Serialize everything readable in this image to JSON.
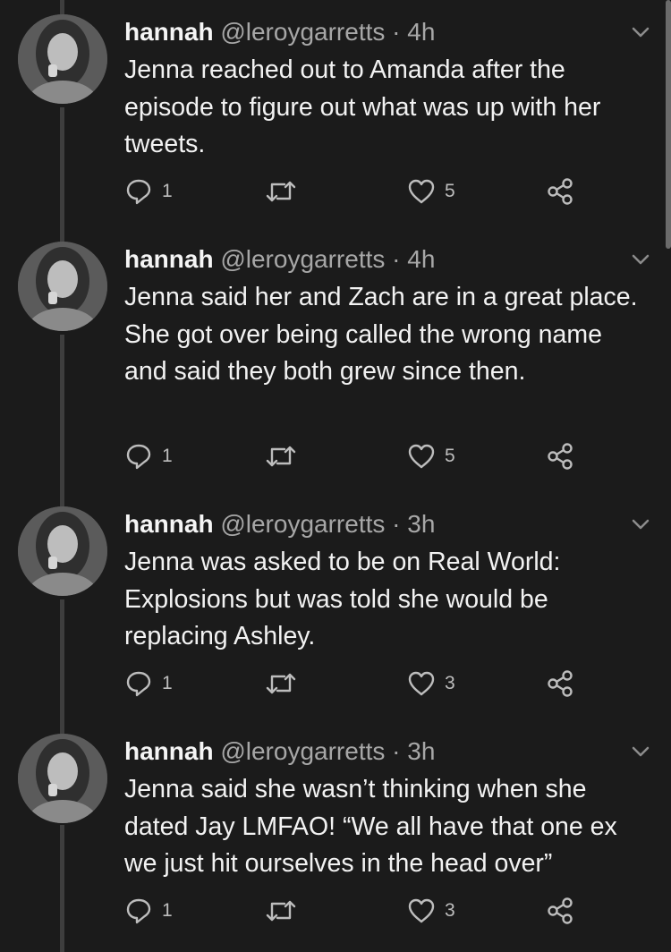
{
  "thread": {
    "tweets": [
      {
        "name": "hannah",
        "handle": "@leroygarretts",
        "separator": " · ",
        "time": "4h",
        "text": "Jenna reached out to Amanda after the episode to figure out what was up with her tweets.",
        "replies": "1",
        "likes": "5"
      },
      {
        "name": "hannah",
        "handle": "@leroygarretts",
        "separator": " · ",
        "time": "4h",
        "text": "Jenna said her and Zach are in a great place. She got over being called the wrong name and said they both grew since then.",
        "replies": "1",
        "likes": "5"
      },
      {
        "name": "hannah",
        "handle": "@leroygarretts",
        "separator": " · ",
        "time": "3h",
        "text": "Jenna was asked to be on Real World: Explosions but was told she would be replacing Ashley.",
        "replies": "1",
        "likes": "3"
      },
      {
        "name": "hannah",
        "handle": "@leroygarretts",
        "separator": " · ",
        "time": "3h",
        "text": "Jenna said she wasn’t thinking when she dated Jay LMFAO! “We all have that one ex we just hit ourselves in the head over”",
        "replies": "1",
        "likes": "3"
      }
    ]
  },
  "icons": {
    "reply": "reply-icon",
    "retweet": "retweet-icon",
    "like": "heart-icon",
    "share": "share-icon",
    "more": "chevron-down-icon"
  },
  "colors": {
    "background": "#1b1b1b",
    "text": "#f2f2f2",
    "secondary": "#a7a7a7",
    "thread_line": "#3e3e3e"
  }
}
